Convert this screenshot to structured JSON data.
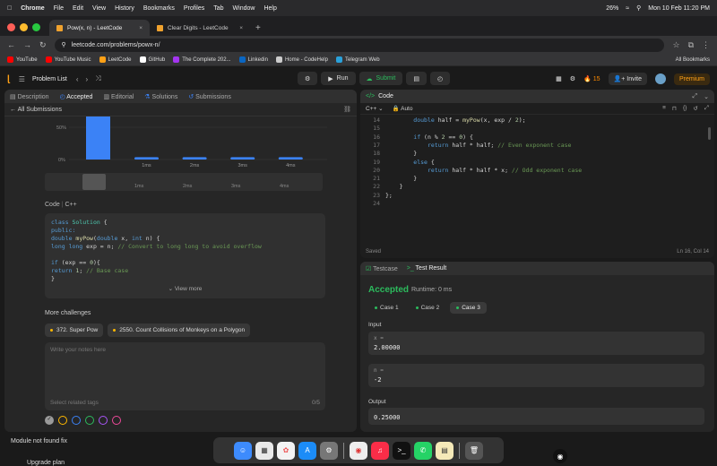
{
  "menubar": {
    "app": "Chrome",
    "menus": [
      "File",
      "Edit",
      "View",
      "History",
      "Bookmarks",
      "Profiles",
      "Tab",
      "Window",
      "Help"
    ],
    "battery": "26%",
    "datetime": "Mon 10 Feb  11:20 PM"
  },
  "tabs": [
    {
      "title": "Pow(x, n) - LeetCode",
      "active": true
    },
    {
      "title": "Clear Digits - LeetCode",
      "active": false
    }
  ],
  "address": {
    "url": "leetcode.com/problems/powx-n/"
  },
  "bookmarks": [
    {
      "label": "YouTube",
      "color": "#ff0000"
    },
    {
      "label": "YouTube Music",
      "color": "#ff0000"
    },
    {
      "label": "LeetCode",
      "color": "#ffa116"
    },
    {
      "label": "GitHub",
      "color": "#ffffff"
    },
    {
      "label": "The Complete 202...",
      "color": "#a435f0"
    },
    {
      "label": "Linkedin",
      "color": "#0a66c2"
    },
    {
      "label": "Home - CodeHelp",
      "color": "#cccccc"
    },
    {
      "label": "Telegram Web",
      "color": "#2aa1da"
    }
  ],
  "all_bookmarks": "All Bookmarks",
  "lcnav": {
    "problem_list": "Problem List",
    "run": "Run",
    "submit": "Submit",
    "streak": "15",
    "invite": "Invite",
    "premium": "Premium"
  },
  "left_tabs": {
    "description": "Description",
    "accepted": "Accepted",
    "editorial": "Editorial",
    "solutions": "Solutions",
    "submissions": "Submissions"
  },
  "all_submissions": "All Submissions",
  "chart_data": {
    "type": "bar",
    "categories": [
      "",
      "1ms",
      "2ms",
      "3ms",
      "4ms"
    ],
    "values": [
      82,
      4,
      4,
      4,
      4
    ],
    "yticks": [
      "50%",
      "0%"
    ],
    "ylim": [
      0,
      100
    ]
  },
  "mini_labels": [
    "1ms",
    "2ms",
    "3ms",
    "4ms"
  ],
  "code_section": {
    "label": "Code",
    "lang": "C++"
  },
  "submitted_code": [
    [
      {
        "t": "class ",
        "c": "kw"
      },
      {
        "t": "Solution",
        "c": "ty"
      },
      {
        "t": " {",
        "c": "tx"
      }
    ],
    [
      {
        "t": "public:",
        "c": "kw"
      }
    ],
    [
      {
        "t": "    double ",
        "c": "kw"
      },
      {
        "t": "myPow",
        "c": "fn"
      },
      {
        "t": "(",
        "c": "tx"
      },
      {
        "t": "double",
        "c": "kw"
      },
      {
        "t": " x, ",
        "c": "tx"
      },
      {
        "t": "int",
        "c": "kw"
      },
      {
        "t": " n) {",
        "c": "tx"
      }
    ],
    [
      {
        "t": "        long long",
        "c": "kw"
      },
      {
        "t": " exp = n; ",
        "c": "tx"
      },
      {
        "t": "// Convert to long long to avoid overflow",
        "c": "cm"
      }
    ],
    [
      {
        "t": "",
        "c": "tx"
      }
    ],
    [
      {
        "t": "        if",
        "c": "kw"
      },
      {
        "t": " (exp == ",
        "c": "tx"
      },
      {
        "t": "0",
        "c": "nm"
      },
      {
        "t": "){",
        "c": "tx"
      }
    ],
    [
      {
        "t": "            return ",
        "c": "kw"
      },
      {
        "t": "1",
        "c": "nm"
      },
      {
        "t": "; ",
        "c": "tx"
      },
      {
        "t": "// Base case",
        "c": "cm"
      }
    ],
    [
      {
        "t": "        }",
        "c": "tx"
      }
    ]
  ],
  "view_more": "View more",
  "more_challenges": {
    "label": "More challenges",
    "items": [
      "372. Super Pow",
      "2550. Count Collisions of Monkeys on a Polygon"
    ]
  },
  "notes": {
    "placeholder": "Write your notes here",
    "tags_placeholder": "Select related tags",
    "count": "0/5"
  },
  "note_colors": [
    "#9a9a9a",
    "#ffb800",
    "#3b82f6",
    "#2cbb5d",
    "#a855f7",
    "#ec4899"
  ],
  "code_panel": {
    "title": "Code",
    "language": "C++",
    "mode": "Auto",
    "status": "Saved",
    "cursor": "Ln 16, Col 14"
  },
  "editor_lines": [
    {
      "n": "14",
      "tokens": [
        {
          "t": "        double",
          "c": "kw"
        },
        {
          "t": " half = ",
          "c": "tx"
        },
        {
          "t": "myPow",
          "c": "fn"
        },
        {
          "t": "(x, exp / ",
          "c": "tx"
        },
        {
          "t": "2",
          "c": "nm"
        },
        {
          "t": ");",
          "c": "tx"
        }
      ]
    },
    {
      "n": "15",
      "tokens": [
        {
          "t": "",
          "c": "tx"
        }
      ]
    },
    {
      "n": "16",
      "tokens": [
        {
          "t": "        if",
          "c": "kw"
        },
        {
          "t": " (n % ",
          "c": "tx"
        },
        {
          "t": "2",
          "c": "nm"
        },
        {
          "t": " == ",
          "c": "tx"
        },
        {
          "t": "0",
          "c": "nm"
        },
        {
          "t": ") {",
          "c": "tx"
        }
      ]
    },
    {
      "n": "17",
      "tokens": [
        {
          "t": "            return",
          "c": "kw"
        },
        {
          "t": " half * half; ",
          "c": "tx"
        },
        {
          "t": "// Even exponent case",
          "c": "cm"
        }
      ]
    },
    {
      "n": "18",
      "tokens": [
        {
          "t": "        }",
          "c": "tx"
        }
      ]
    },
    {
      "n": "19",
      "tokens": [
        {
          "t": "        else",
          "c": "kw"
        },
        {
          "t": " {",
          "c": "tx"
        }
      ]
    },
    {
      "n": "20",
      "tokens": [
        {
          "t": "            return",
          "c": "kw"
        },
        {
          "t": " half * half * x; ",
          "c": "tx"
        },
        {
          "t": "// Odd exponent case",
          "c": "cm"
        }
      ]
    },
    {
      "n": "21",
      "tokens": [
        {
          "t": "        }",
          "c": "tx"
        }
      ]
    },
    {
      "n": "22",
      "tokens": [
        {
          "t": "    }",
          "c": "tx"
        }
      ]
    },
    {
      "n": "23",
      "tokens": [
        {
          "t": "};",
          "c": "tx"
        }
      ]
    },
    {
      "n": "24",
      "tokens": [
        {
          "t": "",
          "c": "tx"
        }
      ]
    }
  ],
  "test_panel": {
    "testcase": "Testcase",
    "test_result": "Test Result",
    "accepted": "Accepted",
    "runtime": "Runtime: 0 ms",
    "cases": [
      "Case 1",
      "Case 2",
      "Case 3"
    ],
    "input_label": "Input",
    "inputs": [
      {
        "name": "x =",
        "value": "2.00000"
      },
      {
        "name": "n =",
        "value": "-2"
      }
    ],
    "output_label": "Output",
    "output": "0.25000"
  },
  "toasts": {
    "top": "Module not found fix",
    "bottom": "Upgrade plan"
  }
}
